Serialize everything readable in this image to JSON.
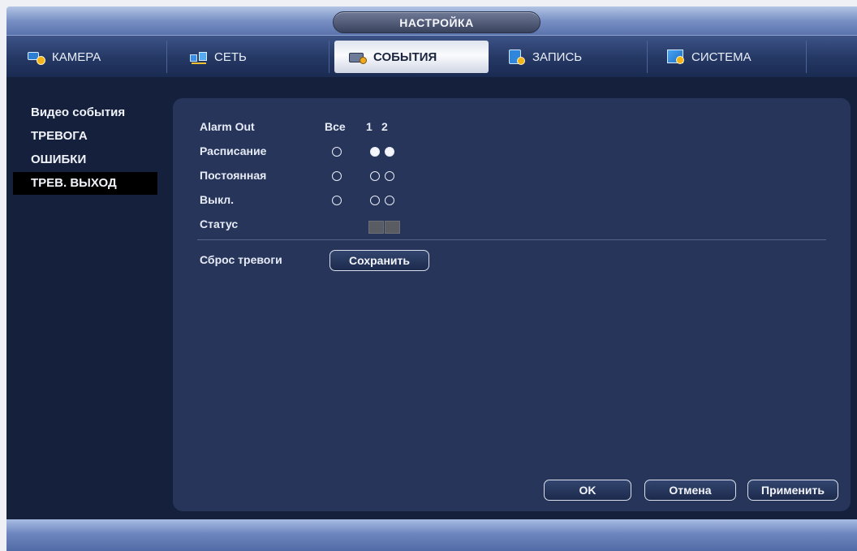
{
  "window": {
    "title": "НАСТРОЙКА"
  },
  "tabs": [
    {
      "label": "КАМЕРА",
      "icon": "camera-icon",
      "active": false
    },
    {
      "label": "СЕТЬ",
      "icon": "network-icon",
      "active": false
    },
    {
      "label": "СОБЫТИЯ",
      "icon": "events-icon",
      "active": true
    },
    {
      "label": "ЗАПИСЬ",
      "icon": "record-icon",
      "active": false
    },
    {
      "label": "СИСТЕМА",
      "icon": "system-icon",
      "active": false
    }
  ],
  "sidebar": {
    "items": [
      {
        "label": "Видео события",
        "active": false
      },
      {
        "label": "ТРЕВОГА",
        "active": false
      },
      {
        "label": "ОШИБКИ",
        "active": false
      },
      {
        "label": "ТРЕВ. ВЫХОД",
        "active": true
      }
    ]
  },
  "alarm_out": {
    "header_label": "Alarm Out",
    "all_label": "Все",
    "channels": [
      "1",
      "2"
    ],
    "modes": [
      {
        "label": "Расписание",
        "all_selected": false,
        "channel_selected": [
          true,
          true
        ]
      },
      {
        "label": "Постоянная",
        "all_selected": false,
        "channel_selected": [
          false,
          false
        ]
      },
      {
        "label": "Выкл.",
        "all_selected": false,
        "channel_selected": [
          false,
          false
        ]
      }
    ],
    "status_label": "Статус"
  },
  "reset": {
    "label": "Сброс тревоги",
    "button_label": "Сохранить"
  },
  "footer_buttons": {
    "ok": "OK",
    "cancel": "Отмена",
    "apply": "Применить"
  },
  "colors": {
    "accent_active_tab": "#eef1f7",
    "panel_bg": "#27355a",
    "workspace_bg": "#15203c"
  }
}
